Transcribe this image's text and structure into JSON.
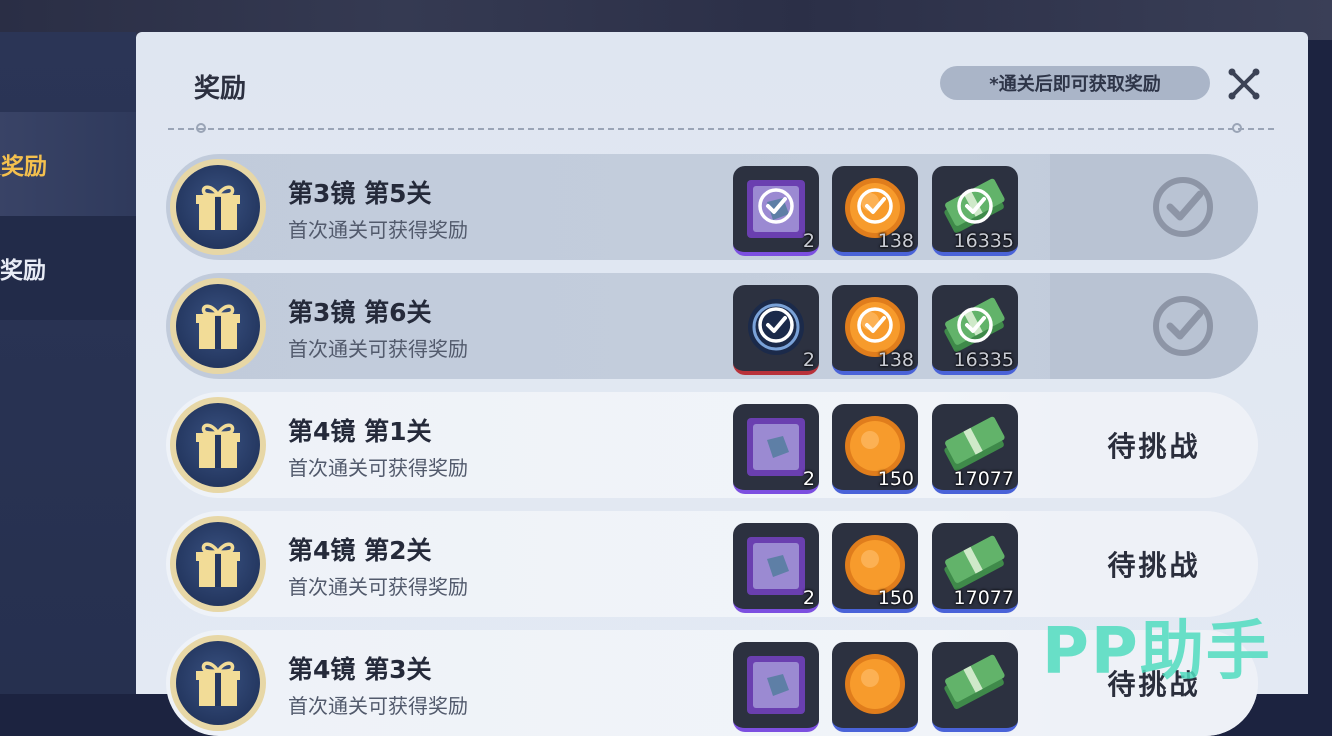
{
  "sidebar": {
    "tabs": [
      {
        "label": "关奖励",
        "active": true
      },
      {
        "label": "日奖励",
        "active": false
      }
    ]
  },
  "panel": {
    "title": "奖励",
    "hint": "*通关后即可获取奖励"
  },
  "rows": [
    {
      "title": "第3镜  第5关",
      "subtitle": "首次通关可获得奖励",
      "status": "claimed",
      "items": [
        {
          "icon": "crate-icon",
          "count": "2"
        },
        {
          "icon": "coin-icon",
          "count": "138"
        },
        {
          "icon": "cash-icon",
          "count": "16335"
        }
      ]
    },
    {
      "title": "第3镜  第6关",
      "subtitle": "首次通关可获得奖励",
      "status": "claimed",
      "items": [
        {
          "icon": "orb-icon",
          "count": "2"
        },
        {
          "icon": "coin-icon",
          "count": "138"
        },
        {
          "icon": "cash-icon",
          "count": "16335"
        }
      ]
    },
    {
      "title": "第4镜  第1关",
      "subtitle": "首次通关可获得奖励",
      "status": "待挑战",
      "items": [
        {
          "icon": "crate-icon",
          "count": "2"
        },
        {
          "icon": "coin-icon",
          "count": "150"
        },
        {
          "icon": "cash-icon",
          "count": "17077"
        }
      ]
    },
    {
      "title": "第4镜  第2关",
      "subtitle": "首次通关可获得奖励",
      "status": "待挑战",
      "items": [
        {
          "icon": "crate-icon",
          "count": "2"
        },
        {
          "icon": "coin-icon",
          "count": "150"
        },
        {
          "icon": "cash-icon",
          "count": "17077"
        }
      ]
    },
    {
      "title": "第4镜  第3关",
      "subtitle": "首次通关可获得奖励",
      "status": "待挑战",
      "items": [
        {
          "icon": "crate-icon",
          "count": ""
        },
        {
          "icon": "coin-icon",
          "count": ""
        },
        {
          "icon": "cash-icon",
          "count": ""
        }
      ]
    }
  ],
  "watermark": "PP助手",
  "colors": {
    "accent": "#f4c04e",
    "gift_rim": "#e7d7a6",
    "watermark": "#50dcbe"
  }
}
